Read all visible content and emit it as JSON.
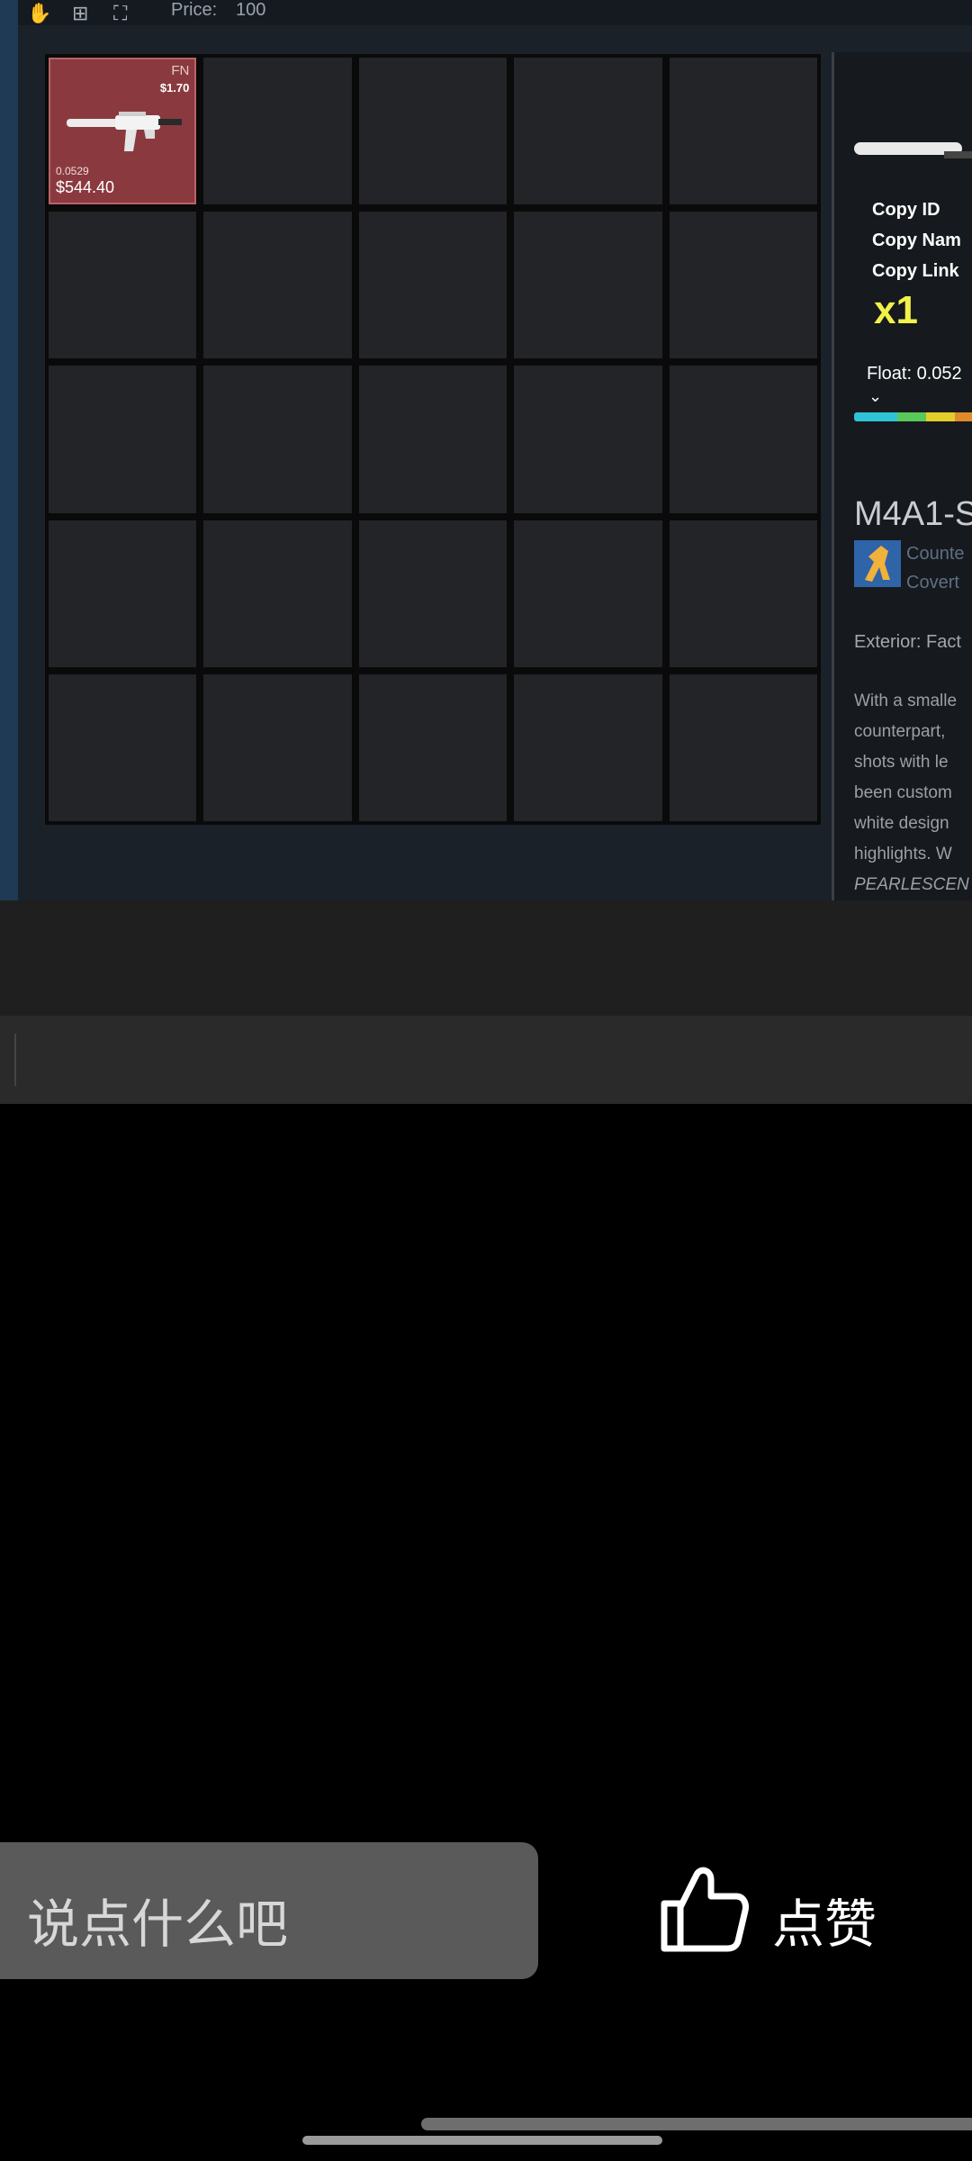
{
  "video": {
    "toolbar": {
      "price_label": "Price:",
      "price_value": "100"
    },
    "inventory_item": {
      "wear": "FN",
      "price_small": "$1.70",
      "float": "0.0529",
      "price": "$544.40"
    },
    "detail": {
      "copy_id": "Copy ID",
      "copy_name": "Copy Nam",
      "copy_link": "Copy Link",
      "quantity": "x1",
      "float_label": "Float: 0.052",
      "weapon_name": "M4A1-S",
      "team": "Counte",
      "rarity": "Covert",
      "exterior": "Exterior: Fact",
      "description_lines": [
        "With a smalle",
        "counterpart,",
        "shots with le",
        "been custom",
        "white design",
        "highlights. W",
        "PEARLESCEN"
      ]
    }
  },
  "comment": {
    "placeholder": "说点什么吧"
  },
  "like": {
    "label": "点赞"
  },
  "colors": {
    "item_bg": "#8a3a3f",
    "quantity": "#f2f24a",
    "banner": "#ff3a3a"
  }
}
